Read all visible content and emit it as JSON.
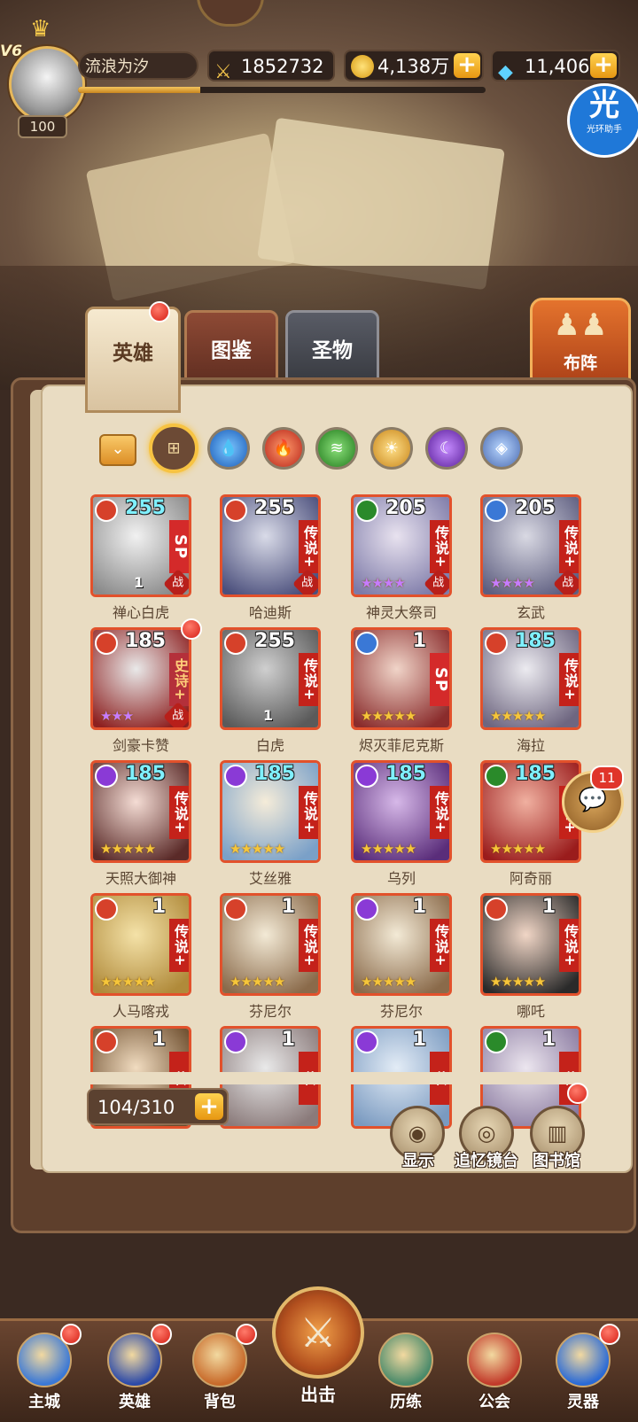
{
  "player": {
    "vip": "V6",
    "level": "100",
    "name": "流浪为汐",
    "exp_fraction": 0.3
  },
  "resources": {
    "power": "1852732",
    "gold": "4,138万",
    "gems": "11,406"
  },
  "helper": {
    "glyph": "光",
    "label": "光环助手"
  },
  "tabs": [
    {
      "label": "英雄",
      "active": true
    },
    {
      "label": "图鉴",
      "active": false
    },
    {
      "label": "圣物",
      "active": false
    }
  ],
  "formation_label": "布阵",
  "element_filters": [
    "all",
    "water",
    "fire",
    "wind",
    "light",
    "dark",
    "void"
  ],
  "heroes": [
    {
      "name": "禅心白虎",
      "level": "255",
      "rank": "SP",
      "stars": "",
      "extra": "1",
      "tag": "战",
      "element": "#d6412a",
      "portrait": [
        "#f1f1f1",
        "#8a8a8a"
      ],
      "lv_cyan": true
    },
    {
      "name": "哈迪斯",
      "level": "255",
      "rank": "传说+",
      "stars": "",
      "extra": "",
      "tag": "战",
      "element": "#d6412a",
      "portrait": [
        "#d9dbe8",
        "#4b4f7c"
      ],
      "lv_cyan": false
    },
    {
      "name": "神灵大祭司",
      "level": "205",
      "rank": "传说+",
      "stars": "★★★★",
      "extra": "",
      "tag": "战",
      "element": "#2a8a2a",
      "portrait": [
        "#e8e2ef",
        "#7d7aa8"
      ],
      "lv_cyan": false,
      "purple": true
    },
    {
      "name": "玄武",
      "level": "205",
      "rank": "传说+",
      "stars": "★★★★",
      "extra": "",
      "tag": "战",
      "element": "#3a78d6",
      "portrait": [
        "#d9d9e3",
        "#5e5e80"
      ],
      "lv_cyan": false,
      "purple": true
    },
    {
      "name": "剑豪卡赞",
      "level": "185",
      "rank": "史诗+",
      "stars": "★★★",
      "extra": "",
      "tag": "战",
      "element": "#d6412a",
      "portrait": [
        "#e9e9e9",
        "#8d2020"
      ],
      "lv_cyan": false,
      "purple": true,
      "epic": true
    },
    {
      "name": "白虎",
      "level": "255",
      "rank": "传说+",
      "stars": "",
      "extra": "1",
      "tag": "",
      "element": "#d6412a",
      "portrait": [
        "#cfcfcf",
        "#5a5a5a"
      ],
      "lv_cyan": false
    },
    {
      "name": "烬灭菲尼克斯",
      "level": "1",
      "rank": "SP",
      "stars": "★★★★★",
      "extra": "",
      "tag": "",
      "element": "#3a78d6",
      "portrait": [
        "#f0d4c8",
        "#8a2c2c"
      ],
      "lv_cyan": false
    },
    {
      "name": "海拉",
      "level": "185",
      "rank": "传说+",
      "stars": "★★★★★",
      "extra": "",
      "tag": "",
      "element": "#d6412a",
      "portrait": [
        "#ecebf0",
        "#6e6680"
      ],
      "lv_cyan": true
    },
    {
      "name": "天照大御神",
      "level": "185",
      "rank": "传说+",
      "stars": "★★★★★",
      "extra": "",
      "tag": "",
      "element": "#8a3ad6",
      "portrait": [
        "#f4dcd4",
        "#5a2a28"
      ],
      "lv_cyan": true
    },
    {
      "name": "艾丝雅",
      "level": "185",
      "rank": "传说+",
      "stars": "★★★★★",
      "extra": "",
      "tag": "",
      "element": "#8a3ad6",
      "portrait": [
        "#f5ecd9",
        "#7aa0c8"
      ],
      "lv_cyan": true
    },
    {
      "name": "乌列",
      "level": "185",
      "rank": "传说+",
      "stars": "★★★★★",
      "extra": "",
      "tag": "",
      "element": "#8a3ad6",
      "portrait": [
        "#d6b8e8",
        "#5a2d7a"
      ],
      "lv_cyan": true
    },
    {
      "name": "阿奇丽",
      "level": "185",
      "rank": "传说+",
      "stars": "★★★★★",
      "extra": "",
      "tag": "",
      "element": "#2a8a2a",
      "portrait": [
        "#f0b0a0",
        "#9a1c1c"
      ],
      "lv_cyan": true
    },
    {
      "name": "人马喀戎",
      "level": "1",
      "rank": "传说+",
      "stars": "★★★★★",
      "extra": "",
      "tag": "",
      "element": "#d6412a",
      "portrait": [
        "#f4e2a8",
        "#b08a3a"
      ],
      "lv_cyan": false
    },
    {
      "name": "芬尼尔",
      "level": "1",
      "rank": "传说+",
      "stars": "★★★★★",
      "extra": "",
      "tag": "",
      "element": "#d6412a",
      "portrait": [
        "#f3ead6",
        "#8a6a4a"
      ],
      "lv_cyan": false
    },
    {
      "name": "芬尼尔",
      "level": "1",
      "rank": "传说+",
      "stars": "★★★★★",
      "extra": "",
      "tag": "",
      "element": "#8a3ad6",
      "portrait": [
        "#f3ead6",
        "#8a6a4a"
      ],
      "lv_cyan": false
    },
    {
      "name": "哪吒",
      "level": "1",
      "rank": "传说+",
      "stars": "★★★★★",
      "extra": "",
      "tag": "",
      "element": "#d6412a",
      "portrait": [
        "#f1d6c6",
        "#2a2a2a"
      ],
      "lv_cyan": false
    },
    {
      "name": "",
      "level": "1",
      "rank": "传",
      "stars": "",
      "extra": "",
      "tag": "",
      "element": "#d6412a",
      "portrait": [
        "#f1dcc0",
        "#6a4a2a"
      ],
      "lv_cyan": false
    },
    {
      "name": "",
      "level": "1",
      "rank": "传",
      "stars": "",
      "extra": "",
      "tag": "",
      "element": "#8a3ad6",
      "portrait": [
        "#e9e9e9",
        "#8a7a7a"
      ],
      "lv_cyan": false
    },
    {
      "name": "",
      "level": "1",
      "rank": "传",
      "stars": "",
      "extra": "",
      "tag": "",
      "element": "#8a3ad6",
      "portrait": [
        "#e3ecf6",
        "#7a9ac0"
      ],
      "lv_cyan": false
    },
    {
      "name": "",
      "level": "1",
      "rank": "传",
      "stars": "",
      "extra": "",
      "tag": "",
      "element": "#2a8a2a",
      "portrait": [
        "#ece6ef",
        "#8a7aa0"
      ],
      "lv_cyan": false
    }
  ],
  "hero_count": "104/310",
  "actions": {
    "display": "显示",
    "memory_mirror": "追忆镜台",
    "library": "图书馆"
  },
  "chat": {
    "count": "11"
  },
  "nav": [
    {
      "label": "主城",
      "color": "#3a78d6"
    },
    {
      "label": "英雄",
      "color": "#2c4aa8"
    },
    {
      "label": "背包",
      "color": "#c86a2a"
    },
    {
      "label": "出击",
      "color": "#b24f1e"
    },
    {
      "label": "历练",
      "color": "#4a8a6a"
    },
    {
      "label": "公会",
      "color": "#c23a2a"
    },
    {
      "label": "灵器",
      "color": "#2a6ad6"
    }
  ]
}
